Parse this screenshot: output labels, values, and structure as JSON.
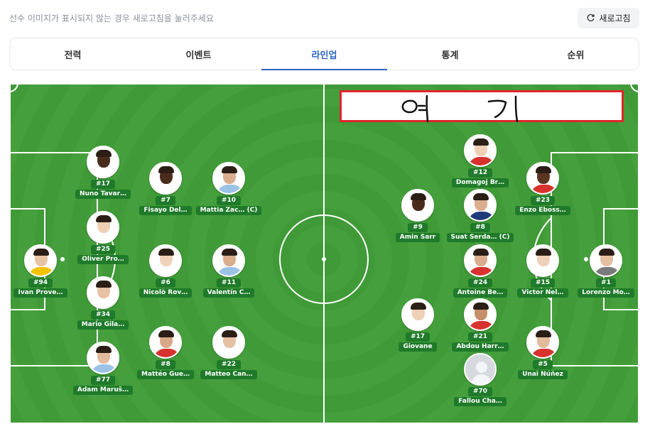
{
  "notice": {
    "text": "선수 이미지가 표시되지 않는 경우 새로고침을 눌러주세요"
  },
  "refresh": {
    "label": "새로고침"
  },
  "tabs": [
    {
      "label": "전력"
    },
    {
      "label": "이벤트"
    },
    {
      "label": "라인업",
      "active": true
    },
    {
      "label": "통계"
    },
    {
      "label": "순위"
    }
  ],
  "annotation": {
    "text": "여 기",
    "color": "#e0262a"
  },
  "players": [
    {
      "number": "#94",
      "name": "Ivan Prove…",
      "skin": "#e8c3a4",
      "shirt": "#f2c300"
    },
    {
      "number": "#17",
      "name": "Nuno Tavar…",
      "skin": "#4a2c1d",
      "shirt": "#ffffff"
    },
    {
      "number": "#25",
      "name": "Oliver Pro…",
      "skin": "#efcfb5",
      "shirt": "#ffffff"
    },
    {
      "number": "#34",
      "name": "Mario Gila…",
      "skin": "#e7c2a4",
      "shirt": "#ffffff"
    },
    {
      "number": "#77",
      "name": "Adam Maruš…",
      "skin": "#e2bb9c",
      "shirt": "#9bc3e6"
    },
    {
      "number": "#7",
      "name": "Fisayo Del…",
      "skin": "#4a2c1d",
      "shirt": "#ffffff"
    },
    {
      "number": "#6",
      "name": "Nicolò Rov…",
      "skin": "#f0d2b8",
      "shirt": "#ffffff"
    },
    {
      "number": "#8",
      "name": "Mattéo Gue…",
      "skin": "#d9a887",
      "shirt": "#d8322e"
    },
    {
      "number": "#10",
      "name": "Mattia Zac… (C)",
      "skin": "#d9ad8e",
      "shirt": "#9bc3e6"
    },
    {
      "number": "#11",
      "name": "Valentín C…",
      "skin": "#d9ad8e",
      "shirt": "#9bc3e6"
    },
    {
      "number": "#22",
      "name": "Matteo Can…",
      "skin": "#e6c0a2",
      "shirt": "#ffffff"
    },
    {
      "number": "#12",
      "name": "Domagoj Br…",
      "skin": "#efcfb5",
      "shirt": "#d8322e"
    },
    {
      "number": "#9",
      "name": "Amin Sarr",
      "skin": "#4a2c1d",
      "shirt": "#ffffff"
    },
    {
      "number": "#8",
      "name": "Suat Serda… (C)",
      "skin": "#d9ad8e",
      "shirt": "#1f3a7a"
    },
    {
      "number": "#24",
      "name": "Antoine Be…",
      "skin": "#d9ad8e",
      "shirt": "#d8322e"
    },
    {
      "number": "#17",
      "name": "Giovane",
      "skin": "#efcfb5",
      "shirt": "#ffffff"
    },
    {
      "number": "#21",
      "name": "Abdou Harr…",
      "skin": "#c58f6b",
      "shirt": "#d8322e"
    },
    {
      "number": "#70",
      "name": "Fallou Cha…",
      "placeholder": true
    },
    {
      "number": "#23",
      "name": "Enzo Eboss…",
      "skin": "#5a3522",
      "shirt": "#d8322e"
    },
    {
      "number": "#15",
      "name": "Victor Nel…",
      "skin": "#efcfb5",
      "shirt": "#ffffff"
    },
    {
      "number": "#5",
      "name": "Unai Núñez",
      "skin": "#e2bb9c",
      "shirt": "#d8322e"
    },
    {
      "number": "#1",
      "name": "Lorenzo Mo…",
      "skin": "#e6c0a2",
      "shirt": "#7a7a7a"
    }
  ]
}
